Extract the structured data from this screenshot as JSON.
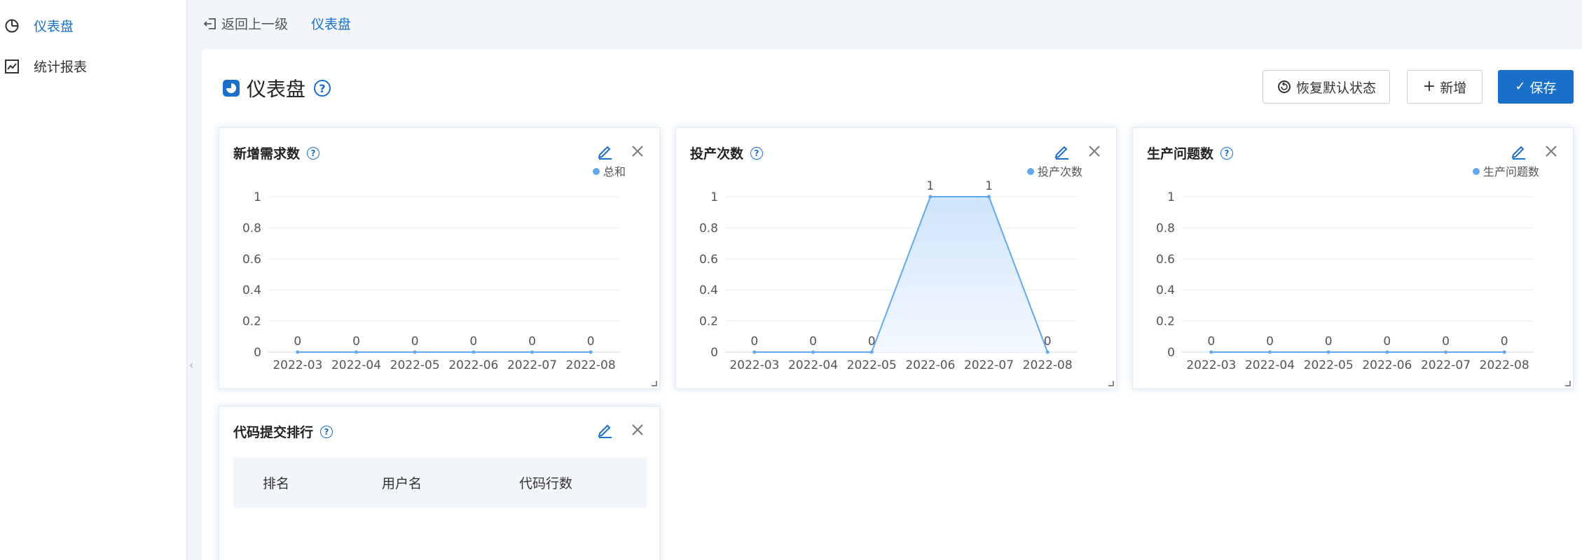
{
  "sidebar": {
    "items": [
      {
        "label": "仪表盘",
        "icon": "pie-chart-icon",
        "active": true
      },
      {
        "label": "统计报表",
        "icon": "line-chart-icon",
        "active": false
      }
    ]
  },
  "topbar": {
    "back_label": "返回上一级",
    "breadcrumb": "仪表盘"
  },
  "page": {
    "title": "仪表盘",
    "help": "?"
  },
  "toolbar": {
    "restore_label": "恢复默认状态",
    "add_label": "新增",
    "save_label": "保存"
  },
  "colors": {
    "accent": "#1a6fc9",
    "series": "#62a8ec",
    "area_top": "#cfe4fa",
    "area_bottom": "#f4f9ff"
  },
  "cards": [
    {
      "title": "新增需求数",
      "help": "?"
    },
    {
      "title": "投产次数",
      "help": "?"
    },
    {
      "title": "生产问题数",
      "help": "?"
    },
    {
      "title": "代码提交排行",
      "help": "?"
    }
  ],
  "chart_data": [
    {
      "type": "area",
      "categories": [
        "2022-03",
        "2022-04",
        "2022-05",
        "2022-06",
        "2022-07",
        "2022-08"
      ],
      "series": [
        {
          "name": "总和",
          "values": [
            0,
            0,
            0,
            0,
            0,
            0
          ]
        }
      ],
      "ylim": [
        0,
        1
      ],
      "yticks": [
        "0",
        "0.2",
        "0.4",
        "0.6",
        "0.8",
        "1"
      ],
      "data_labels": true,
      "grid": true,
      "legend": "top-right"
    },
    {
      "type": "area",
      "categories": [
        "2022-03",
        "2022-04",
        "2022-05",
        "2022-06",
        "2022-07",
        "2022-08"
      ],
      "series": [
        {
          "name": "投产次数",
          "values": [
            0,
            0,
            0,
            1,
            1,
            0
          ]
        }
      ],
      "ylim": [
        0,
        1
      ],
      "yticks": [
        "0",
        "0.2",
        "0.4",
        "0.6",
        "0.8",
        "1"
      ],
      "data_labels": true,
      "grid": true,
      "legend": "top-right"
    },
    {
      "type": "area",
      "categories": [
        "2022-03",
        "2022-04",
        "2022-05",
        "2022-06",
        "2022-07",
        "2022-08"
      ],
      "series": [
        {
          "name": "生产问题数",
          "values": [
            0,
            0,
            0,
            0,
            0,
            0
          ]
        }
      ],
      "ylim": [
        0,
        1
      ],
      "yticks": [
        "0",
        "0.2",
        "0.4",
        "0.6",
        "0.8",
        "1"
      ],
      "data_labels": true,
      "grid": true,
      "legend": "top-right"
    }
  ],
  "table": {
    "columns": [
      "排名",
      "用户名",
      "代码行数"
    ]
  }
}
